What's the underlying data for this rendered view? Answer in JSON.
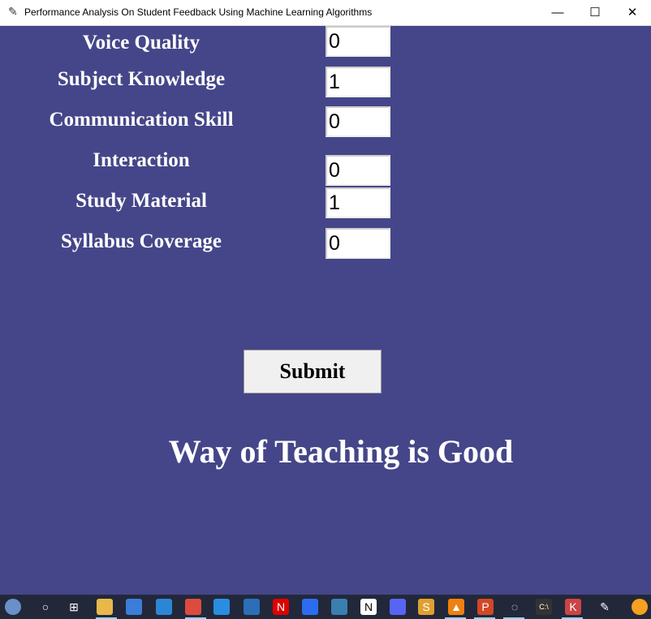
{
  "window": {
    "title": "Performance Analysis On Student Feedback Using Machine Learning Algorithms"
  },
  "form": {
    "fields": [
      {
        "label": "Voice Quality",
        "value": "0"
      },
      {
        "label": "Subject Knowledge",
        "value": "1"
      },
      {
        "label": "Communication Skill",
        "value": "0"
      },
      {
        "label": "Interaction",
        "value": "0"
      },
      {
        "label": "Study Material",
        "value": "1"
      },
      {
        "label": "Syllabus Coverage",
        "value": "0"
      }
    ],
    "submit_label": "Submit"
  },
  "result": "Way of Teaching is Good",
  "colors": {
    "background": "#454689",
    "taskbar": "#22283a"
  },
  "taskbar": {
    "icons": [
      "start-app-icon",
      "cortana-icon",
      "task-view-icon",
      "file-explorer-icon",
      "store-icon",
      "mail-icon",
      "chrome-icon",
      "vscode-icon",
      "prime-video-icon",
      "netflix-icon",
      "zoom-icon",
      "mysql-icon",
      "notion-icon",
      "discord-icon",
      "sublime-icon",
      "vlc-icon",
      "powerpoint-icon",
      "spinner-app-icon",
      "cmd-icon",
      "app-icon",
      "tk-feather-icon",
      "orange-app-icon"
    ]
  }
}
